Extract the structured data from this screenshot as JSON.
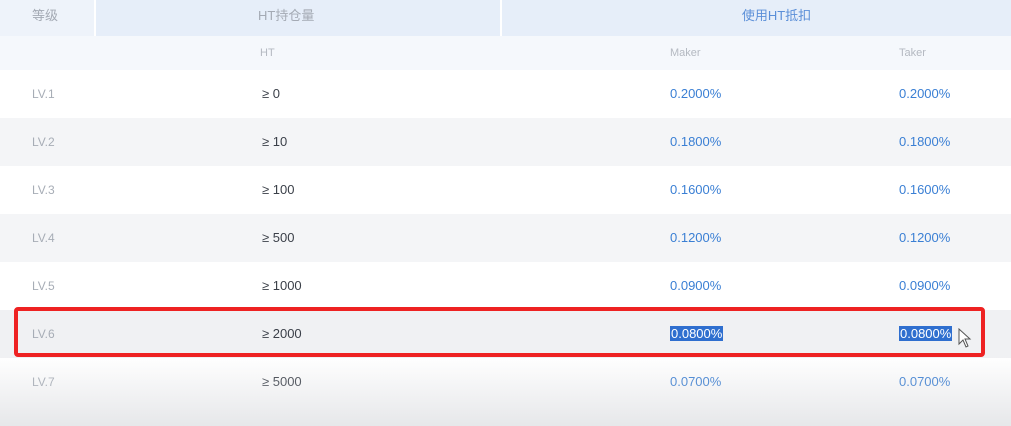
{
  "header": {
    "level": "等级",
    "holding": "HT持仓量",
    "discount": "使用HT抵扣"
  },
  "subheader": {
    "unit": "HT",
    "maker": "Maker",
    "taker": "Taker"
  },
  "rows": [
    {
      "level": "LV.1",
      "holding": "≥ 0",
      "maker": "0.2000%",
      "taker": "0.2000%"
    },
    {
      "level": "LV.2",
      "holding": "≥ 10",
      "maker": "0.1800%",
      "taker": "0.1800%"
    },
    {
      "level": "LV.3",
      "holding": "≥ 100",
      "maker": "0.1600%",
      "taker": "0.1600%"
    },
    {
      "level": "LV.4",
      "holding": "≥ 500",
      "maker": "0.1200%",
      "taker": "0.1200%"
    },
    {
      "level": "LV.5",
      "holding": "≥ 1000",
      "maker": "0.0900%",
      "taker": "0.0900%"
    },
    {
      "level": "LV.6",
      "holding": "≥ 2000",
      "maker": "0.0800%",
      "taker": "0.0800%"
    },
    {
      "level": "LV.7",
      "holding": "≥ 5000",
      "maker": "0.0700%",
      "taker": "0.0700%"
    }
  ],
  "highlight": {
    "row": "LV.6",
    "color": "#ee2222",
    "selection_color": "#2f6fcf"
  },
  "colors": {
    "accent": "#3a7fd4",
    "header_bg": "#e6eef9"
  }
}
